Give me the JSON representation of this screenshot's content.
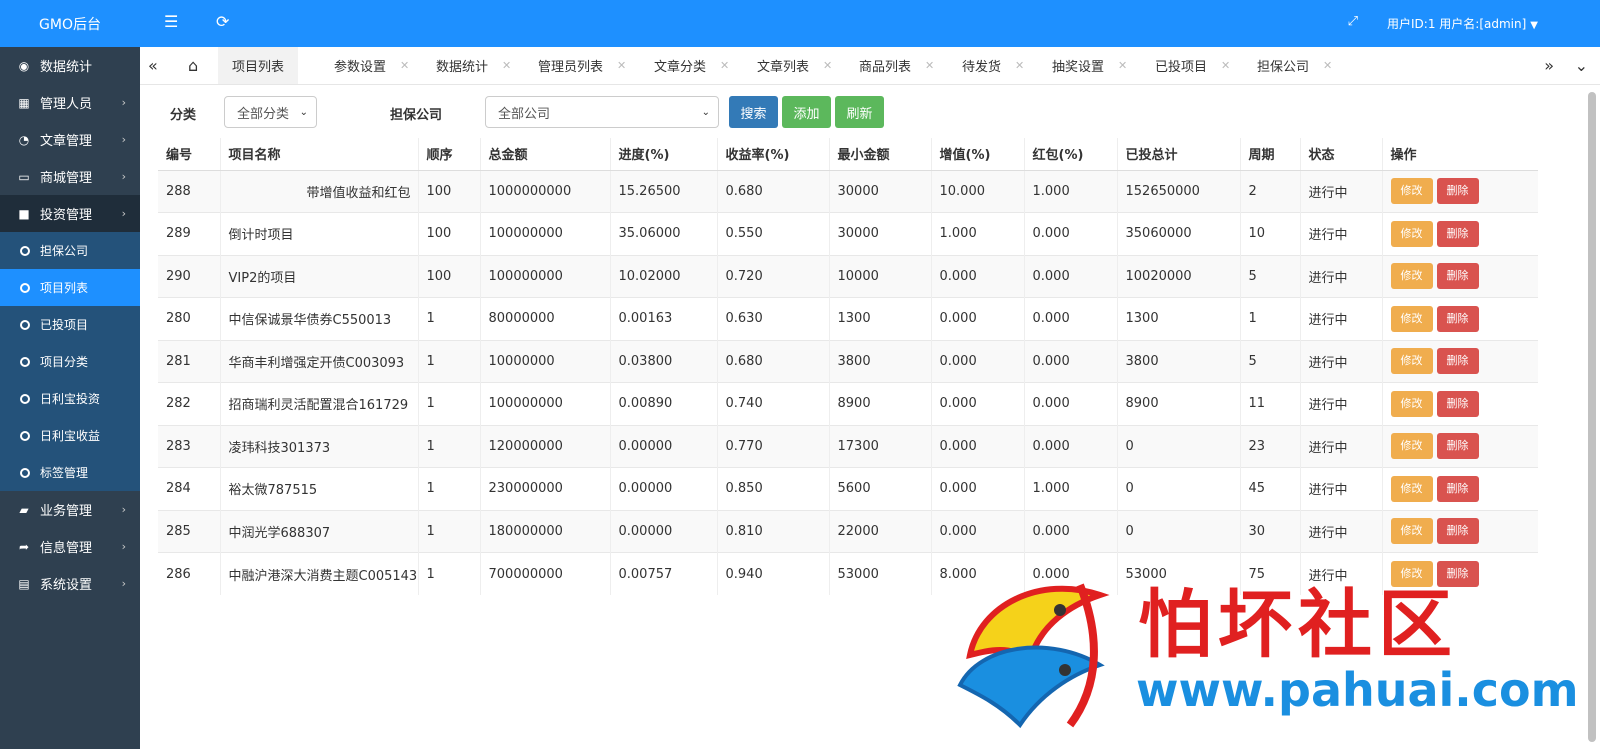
{
  "brand": "GMO后台",
  "topbar": {
    "user_text": "用户ID:1 用户名:[admin]"
  },
  "sidebar": {
    "groups": [
      {
        "label": "数据统计",
        "icon": "dashboard-icon"
      },
      {
        "label": "管理人员",
        "icon": "grid-icon"
      },
      {
        "label": "文章管理",
        "icon": "pie-chart-icon"
      },
      {
        "label": "商城管理",
        "icon": "laptop-icon"
      },
      {
        "label": "投资管理",
        "icon": "folder-icon"
      }
    ],
    "sub_items": [
      "担保公司",
      "项目列表",
      "已投项目",
      "项目分类",
      "日利宝投资",
      "日利宝收益",
      "标签管理"
    ],
    "groups_after": [
      {
        "label": "业务管理",
        "icon": "book-icon"
      },
      {
        "label": "信息管理",
        "icon": "share-icon"
      },
      {
        "label": "系统设置",
        "icon": "calendar-icon"
      }
    ]
  },
  "tabs": [
    "项目列表",
    "参数设置",
    "数据统计",
    "管理员列表",
    "文章分类",
    "文章列表",
    "商品列表",
    "待发货",
    "抽奖设置",
    "已投项目",
    "担保公司"
  ],
  "search": {
    "category_label": "分类",
    "category_value": "全部分类",
    "company_label": "担保公司",
    "company_value": "全部公司",
    "search_btn": "搜索",
    "add_btn": "添加",
    "refresh_btn": "刷新"
  },
  "table": {
    "headers": [
      "编号",
      "项目名称",
      "顺序",
      "总金额",
      "进度(%)",
      "收益率(%)",
      "最小金额",
      "增值(%)",
      "红包(%)",
      "已投总计",
      "周期",
      "状态",
      "操作"
    ],
    "edit_label": "修改",
    "delete_label": "删除",
    "rows": [
      [
        "288",
        "带增值收益和红包",
        "100",
        "1000000000",
        "15.26500",
        "0.680",
        "30000",
        "10.000",
        "1.000",
        "152650000",
        "2",
        "进行中"
      ],
      [
        "289",
        "倒计时项目",
        "100",
        "100000000",
        "35.06000",
        "0.550",
        "30000",
        "1.000",
        "0.000",
        "35060000",
        "10",
        "进行中"
      ],
      [
        "290",
        "VIP2的项目",
        "100",
        "100000000",
        "10.02000",
        "0.720",
        "10000",
        "0.000",
        "0.000",
        "10020000",
        "5",
        "进行中"
      ],
      [
        "280",
        "中信保诚景华债券C550013",
        "1",
        "80000000",
        "0.00163",
        "0.630",
        "1300",
        "0.000",
        "0.000",
        "1300",
        "1",
        "进行中"
      ],
      [
        "281",
        "华商丰利增强定开债C003093",
        "1",
        "10000000",
        "0.03800",
        "0.680",
        "3800",
        "0.000",
        "0.000",
        "3800",
        "5",
        "进行中"
      ],
      [
        "282",
        "招商瑞利灵活配置混合161729",
        "1",
        "100000000",
        "0.00890",
        "0.740",
        "8900",
        "0.000",
        "0.000",
        "8900",
        "11",
        "进行中"
      ],
      [
        "283",
        "凌玮科技301373",
        "1",
        "120000000",
        "0.00000",
        "0.770",
        "17300",
        "0.000",
        "0.000",
        "0",
        "23",
        "进行中"
      ],
      [
        "284",
        "裕太微787515",
        "1",
        "230000000",
        "0.00000",
        "0.850",
        "5600",
        "0.000",
        "1.000",
        "0",
        "45",
        "进行中"
      ],
      [
        "285",
        "中润光学688307",
        "1",
        "180000000",
        "0.00000",
        "0.810",
        "22000",
        "0.000",
        "0.000",
        "0",
        "30",
        "进行中"
      ],
      [
        "286",
        "中融沪港深大消费主题C005143",
        "1",
        "700000000",
        "0.00757",
        "0.940",
        "53000",
        "8.000",
        "0.000",
        "53000",
        "75",
        "进行中"
      ]
    ]
  },
  "watermark": {
    "title": "怕坏社区",
    "url": "www.pahuai.com"
  }
}
